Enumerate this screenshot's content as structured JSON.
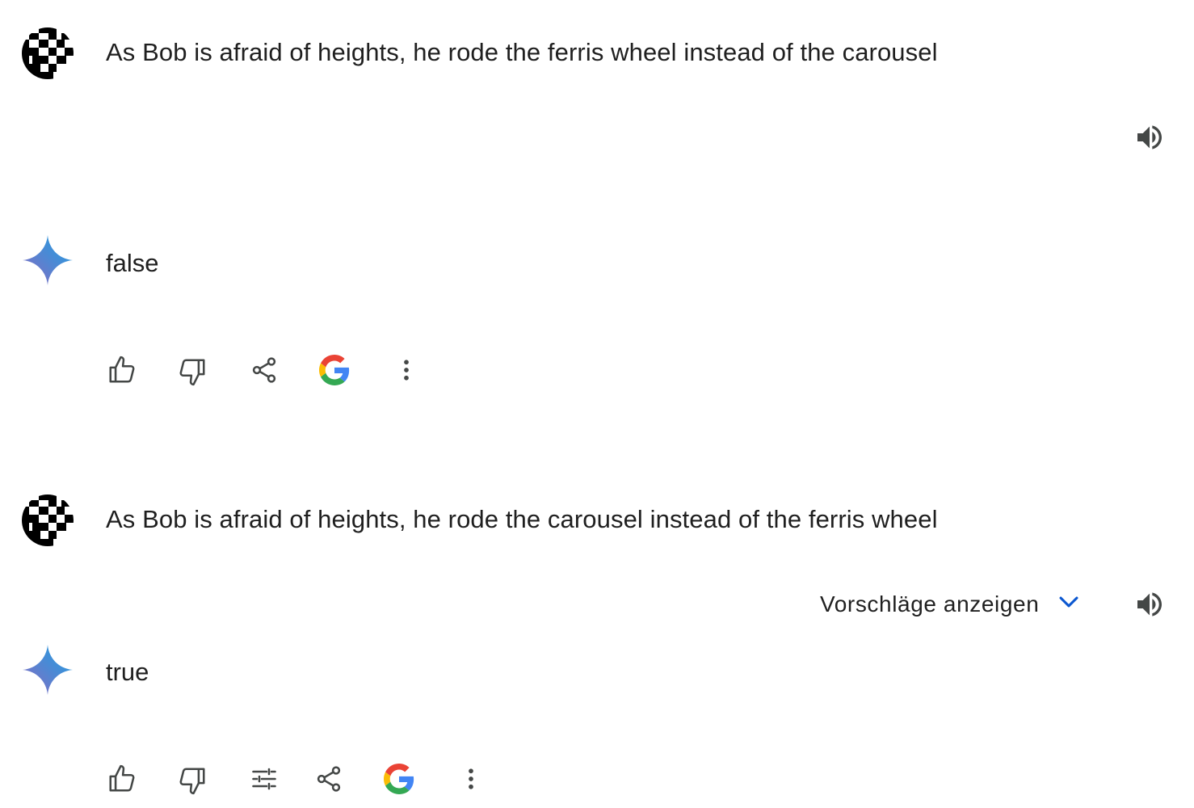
{
  "conversation": [
    {
      "prompt": "As Bob is afraid of heights, he rode the ferris wheel instead of the carousel",
      "response": "false",
      "actions": [
        "thumb-up-icon",
        "thumb-down-icon",
        "share-icon",
        "google-icon",
        "more-vert-icon"
      ]
    },
    {
      "prompt": "As Bob is afraid of heights, he rode the carousel instead of the ferris wheel",
      "show_suggestions_label": "Vorschläge anzeigen",
      "response": "true",
      "actions": [
        "thumb-up-icon",
        "thumb-down-icon",
        "tune-icon",
        "share-icon",
        "google-icon",
        "more-vert-icon"
      ]
    }
  ],
  "colors": {
    "text": "#1f1f1f",
    "icon": "#444746",
    "accent_blue": "#0b57d0",
    "sparkle_start": "#9168c0",
    "sparkle_end": "#1ba1e3"
  }
}
